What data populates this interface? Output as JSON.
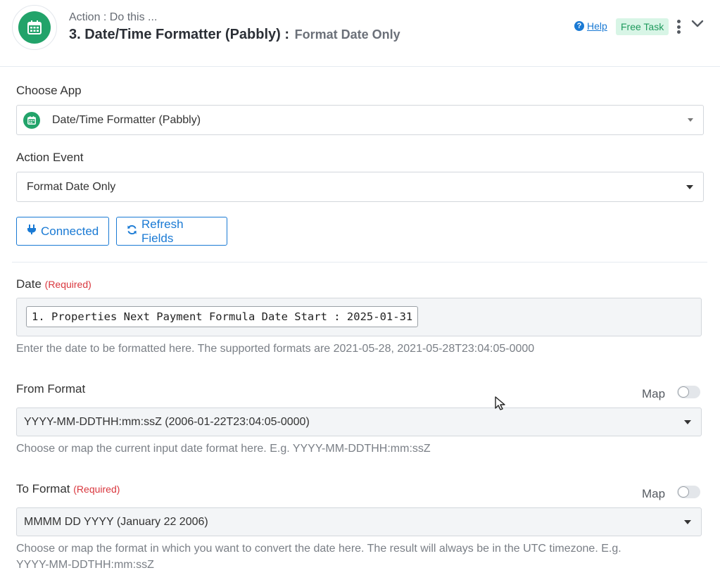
{
  "header": {
    "kicker": "Action : Do this ...",
    "title": "3. Date/Time Formatter (Pabbly) :",
    "subtitle": "Format Date Only",
    "help_label": "Help",
    "badge_label": "Free Task",
    "icon": "calendar-icon"
  },
  "choose_app": {
    "label": "Choose App",
    "value": "Date/Time Formatter (Pabbly)",
    "icon": "calendar-icon"
  },
  "action_event": {
    "label": "Action Event",
    "value": "Format Date Only"
  },
  "buttons": {
    "connected": "Connected",
    "refresh": "Refresh Fields"
  },
  "date_field": {
    "label": "Date",
    "required": "(Required)",
    "chip": "1. Properties Next Payment Formula Date Start : 2025-01-31",
    "hint": "Enter the date to be formatted here. The supported formats are 2021-05-28, 2021-05-28T23:04:05-0000"
  },
  "from_format": {
    "label": "From Format",
    "map_label": "Map",
    "map_enabled": false,
    "value": "YYYY-MM-DDTHH:mm:ssZ (2006-01-22T23:04:05-0000)",
    "hint": "Choose or map the current input date format here. E.g. YYYY-MM-DDTHH:mm:ssZ"
  },
  "to_format": {
    "label": "To Format",
    "required": "(Required)",
    "map_label": "Map",
    "map_enabled": false,
    "value": "MMMM DD YYYY (January 22 2006)",
    "hint_line1": "Choose or map the format in which you want to convert the date here. The result will always be in the UTC timezone. E.g.",
    "hint_line2": "YYYY-MM-DDTHH:mm:ssZ"
  },
  "colors": {
    "accent": "#1a7ad4",
    "app_green": "#22a36a",
    "required_red": "#d9373e",
    "badge_bg": "#d8f5e6"
  }
}
